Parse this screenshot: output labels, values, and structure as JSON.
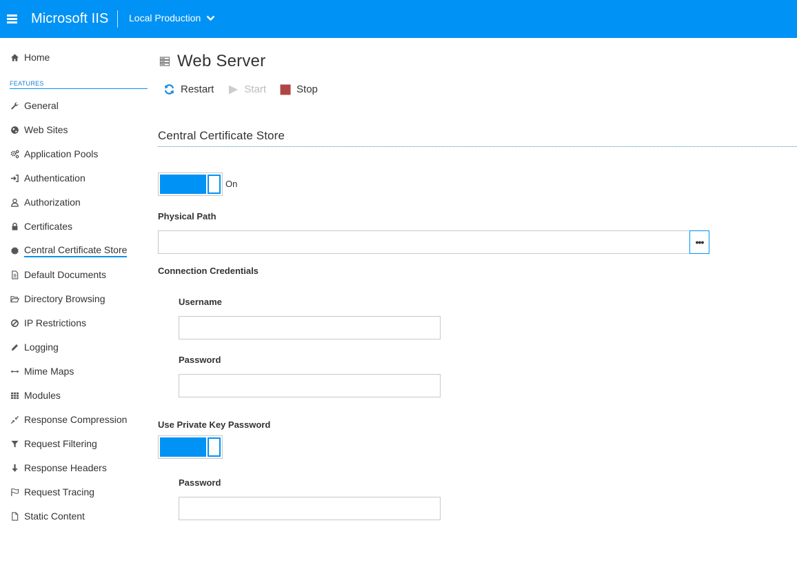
{
  "header": {
    "brand": "Microsoft IIS",
    "server": "Local Production",
    "background": "#0092f5"
  },
  "sidebar": {
    "home": {
      "label": "Home",
      "icon": "home-icon"
    },
    "section_label": "FEATURES",
    "items": [
      {
        "label": "General",
        "icon": "wrench-icon"
      },
      {
        "label": "Web Sites",
        "icon": "globe-icon"
      },
      {
        "label": "Application Pools",
        "icon": "gears-icon"
      },
      {
        "label": "Authentication",
        "icon": "sign-in-icon"
      },
      {
        "label": "Authorization",
        "icon": "user-outline-icon"
      },
      {
        "label": "Certificates",
        "icon": "lock-icon"
      },
      {
        "label": "Central Certificate Store",
        "icon": "certificate-icon",
        "active": true
      },
      {
        "label": "Default Documents",
        "icon": "document-icon"
      },
      {
        "label": "Directory Browsing",
        "icon": "folder-open-icon"
      },
      {
        "label": "IP Restrictions",
        "icon": "ban-icon"
      },
      {
        "label": "Logging",
        "icon": "pencil-icon"
      },
      {
        "label": "Mime Maps",
        "icon": "arrows-horizontal-icon"
      },
      {
        "label": "Modules",
        "icon": "grid-icon"
      },
      {
        "label": "Response Compression",
        "icon": "compress-icon"
      },
      {
        "label": "Request Filtering",
        "icon": "filter-icon"
      },
      {
        "label": "Response Headers",
        "icon": "arrow-down-icon"
      },
      {
        "label": "Request Tracing",
        "icon": "flag-icon"
      },
      {
        "label": "Static Content",
        "icon": "file-icon"
      }
    ]
  },
  "main": {
    "title": "Web Server",
    "actions": {
      "restart": "Restart",
      "start": "Start",
      "stop": "Stop"
    },
    "section_title": "Central Certificate Store",
    "enabled_toggle": {
      "label": "On",
      "on": true
    },
    "physical_path": {
      "label": "Physical Path",
      "value": "",
      "browse": "•••"
    },
    "connection_credentials": {
      "label": "Connection Credentials",
      "username": {
        "label": "Username",
        "value": ""
      },
      "password": {
        "label": "Password",
        "value": ""
      }
    },
    "private_key": {
      "label": "Use Private Key Password",
      "on": true,
      "password": {
        "label": "Password",
        "value": ""
      }
    }
  },
  "colors": {
    "accent": "#0092f5",
    "stop": "#b04545",
    "disabled": "#bbbbbb"
  }
}
